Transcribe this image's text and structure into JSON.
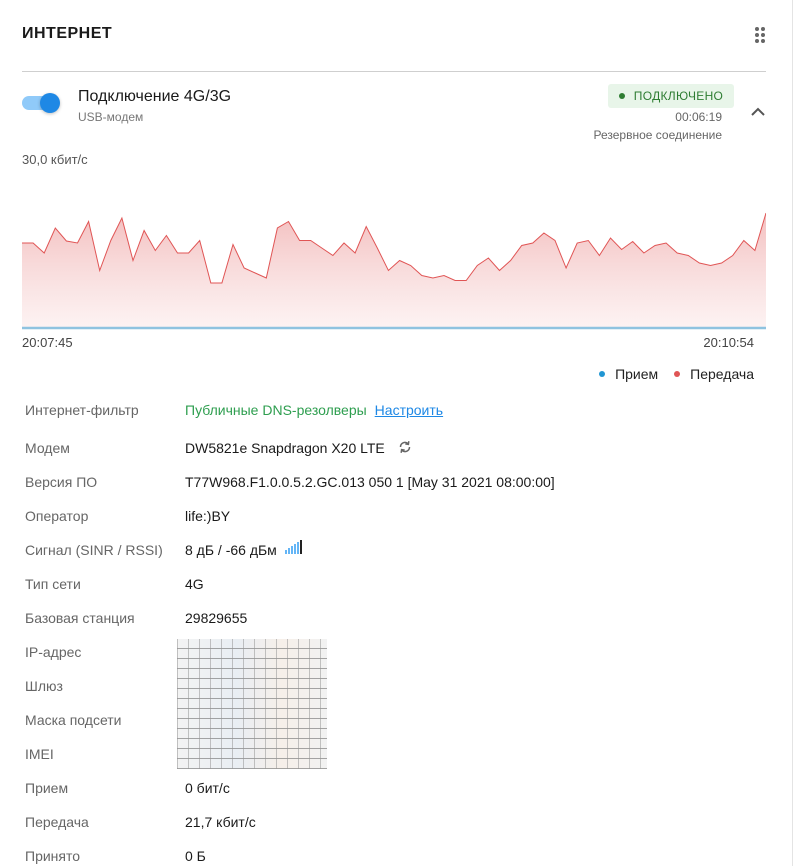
{
  "panel": {
    "title": "ИНТЕРНЕТ"
  },
  "connection": {
    "name": "Подключение 4G/3G",
    "type": "USB-модем",
    "enabled": true,
    "status": "ПОДКЛЮЧЕНО",
    "uptime": "00:06:19",
    "role": "Резервное соединение"
  },
  "chart_data": {
    "type": "area",
    "title": "",
    "max_label": "30,0 кбит/с",
    "ylim": [
      0,
      30
    ],
    "x_start": "20:07:45",
    "x_end": "20:10:54",
    "legend_position": "bottom-right",
    "series": [
      {
        "name": "Прием",
        "color": "#2196d3",
        "values": [
          0,
          0,
          0,
          0,
          0,
          0,
          0,
          0,
          0,
          0,
          0,
          0,
          0,
          0,
          0,
          0,
          0,
          0,
          0,
          0,
          0,
          0,
          0,
          0,
          0,
          0,
          0,
          0,
          0,
          0,
          0,
          0,
          0,
          0,
          0,
          0,
          0,
          0,
          0,
          0,
          0,
          0,
          0,
          0,
          0,
          0,
          0,
          0,
          0,
          0,
          0,
          0,
          0,
          0,
          0,
          0,
          0,
          0,
          0,
          0,
          0,
          0,
          0,
          0,
          0,
          0,
          0,
          0,
          0,
          0,
          0,
          0,
          0,
          0,
          0,
          0
        ]
      },
      {
        "name": "Передача",
        "color": "#e05555",
        "values": [
          17.0,
          17.0,
          15.0,
          20.0,
          17.4,
          17.0,
          21.3,
          11.5,
          17.5,
          22.0,
          13.5,
          19.5,
          15.5,
          18.5,
          15.0,
          15.0,
          17.5,
          9.0,
          9.0,
          16.7,
          12.0,
          11.0,
          10.0,
          20.0,
          21.3,
          17.5,
          17.5,
          16.0,
          14.5,
          17.0,
          15.0,
          20.3,
          16.0,
          11.5,
          13.5,
          12.5,
          10.5,
          10.0,
          10.5,
          9.5,
          9.5,
          12.5,
          14.0,
          11.5,
          13.5,
          16.5,
          17.0,
          19.0,
          17.5,
          12.0,
          17.0,
          17.5,
          14.5,
          18.0,
          15.7,
          17.3,
          15.0,
          16.5,
          17.0,
          15.0,
          14.5,
          13.0,
          12.5,
          13.0,
          14.5,
          17.5,
          15.5,
          23.0
        ]
      }
    ]
  },
  "legend": {
    "rx": "Прием",
    "tx": "Передача",
    "rx_color": "#2196d3",
    "tx_color": "#e05555"
  },
  "details": {
    "filter": {
      "label": "Интернет-фильтр",
      "value": "Публичные DNS-резолверы",
      "link": "Настроить"
    },
    "modem": {
      "label": "Модем",
      "value": "DW5821e Snapdragon X20 LTE"
    },
    "firmware": {
      "label": "Версия ПО",
      "value": "T77W968.F1.0.0.5.2.GC.013 050 1 [May 31 2021 08:00:00]"
    },
    "operator": {
      "label": "Оператор",
      "value": "life:)BY"
    },
    "signal": {
      "label": "Сигнал (SINR / RSSI)",
      "value": "8 дБ / -66 дБм"
    },
    "network": {
      "label": "Тип сети",
      "value": "4G"
    },
    "station": {
      "label": "Базовая станция",
      "value": "29829655"
    },
    "ip": {
      "label": "IP-адрес"
    },
    "gateway": {
      "label": "Шлюз"
    },
    "mask": {
      "label": "Маска подсети"
    },
    "imei": {
      "label": "IMEI"
    },
    "rx": {
      "label": "Прием",
      "value": "0 бит/с"
    },
    "tx": {
      "label": "Передача",
      "value": "21,7 кбит/с"
    },
    "received": {
      "label": "Принято",
      "value": "0 Б"
    }
  }
}
